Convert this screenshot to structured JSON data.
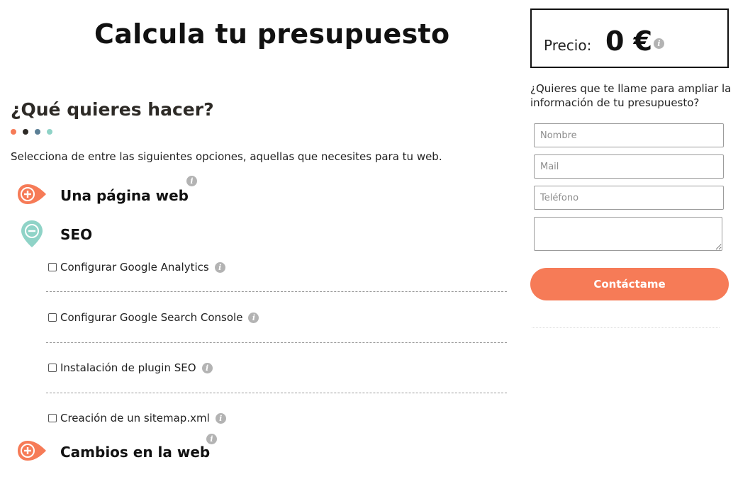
{
  "title": "Calcula tu presupuesto",
  "section": {
    "heading": "¿Qué quieres hacer?",
    "intro": "Selecciona de entre las siguientes opciones, aquellas que necesites para tu web.",
    "dot_colors": [
      "#f67b57",
      "#2d2a26",
      "#5b7f95",
      "#8fd3c7"
    ]
  },
  "categories": [
    {
      "label": "Una página web",
      "state": "collapsed",
      "icon": "plus-icon",
      "color": "#f67b57"
    },
    {
      "label": "SEO",
      "state": "expanded",
      "icon": "minus-icon",
      "color": "#8fd3c7"
    },
    {
      "label": "Cambios en la web",
      "state": "collapsed",
      "icon": "plus-icon",
      "color": "#f67b57"
    }
  ],
  "seo_options": [
    {
      "label": "Configurar Google Analytics",
      "checked": false
    },
    {
      "label": "Configurar Google Search Console",
      "checked": false
    },
    {
      "label": "Instalación de plugin SEO",
      "checked": false
    },
    {
      "label": "Creación de un sitemap.xml",
      "checked": false
    }
  ],
  "price": {
    "label": "Precio:",
    "value": "0 €"
  },
  "contact": {
    "prompt": "¿Quieres que te llame para ampliar la información de tu presupuesto?",
    "name_placeholder": "Nombre",
    "mail_placeholder": "Mail",
    "phone_placeholder": "Teléfono",
    "message_placeholder": "",
    "button_label": "Contáctame"
  },
  "colors": {
    "accent": "#f67b57",
    "teal": "#8fd3c7",
    "info": "#b3b3b3"
  }
}
